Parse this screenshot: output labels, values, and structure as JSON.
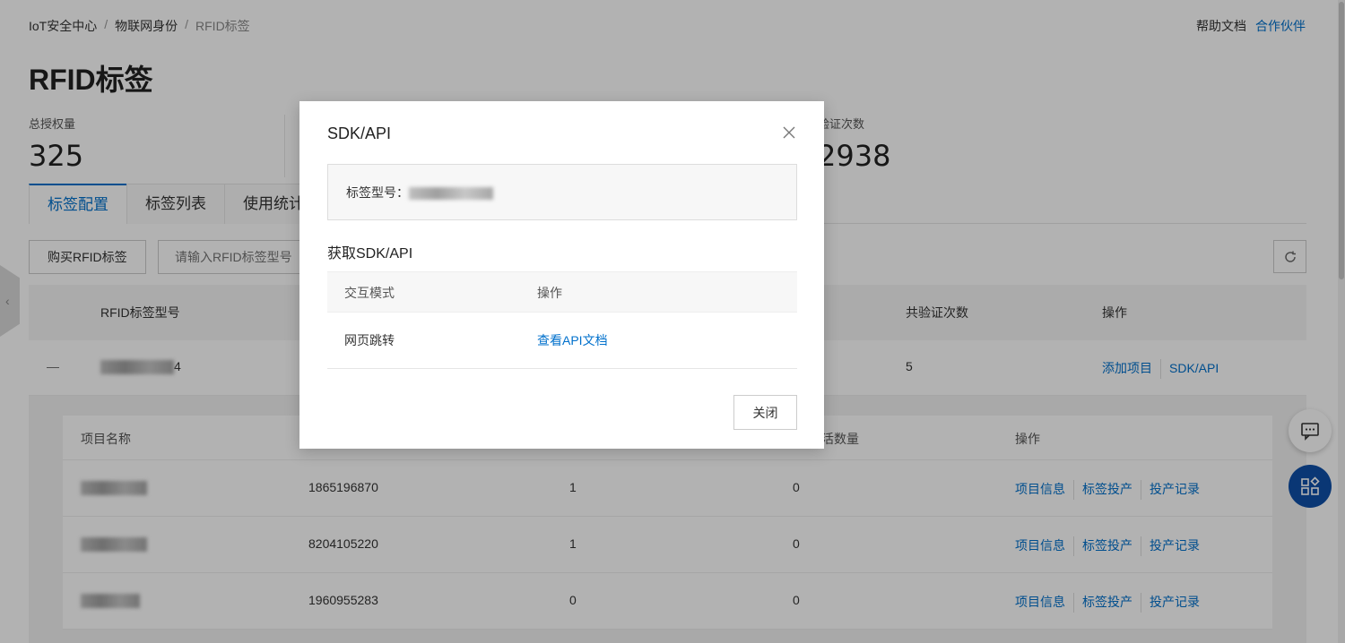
{
  "breadcrumb": [
    "IoT安全中心",
    "物联网身份",
    "RFID标签"
  ],
  "top_links": {
    "help": "帮助文档",
    "partner": "合作伙伴"
  },
  "page_title": "RFID标签",
  "stats": [
    {
      "label": "总授权量",
      "value": "325"
    },
    {
      "label": "验证次数",
      "value": "2938"
    }
  ],
  "tabs": [
    "标签配置",
    "标签列表",
    "使用统计"
  ],
  "toolbar": {
    "buy_label": "购买RFID标签",
    "search_placeholder": "请输入RFID标签型号"
  },
  "main_table": {
    "headers": {
      "model": "RFID标签型号",
      "verify_count": "共验证次数",
      "actions": "操作"
    },
    "row": {
      "collapse": "—",
      "model_suffix": "4",
      "verify_count": "5",
      "add_project": "添加项目",
      "sdk_api": "SDK/API"
    }
  },
  "sub_table": {
    "headers": {
      "name": "项目名称",
      "count_suffix": "活数量",
      "actions": "操作"
    },
    "rows": [
      {
        "id": "1865196870",
        "a": "1",
        "b": "0"
      },
      {
        "id": "8204105220",
        "a": "1",
        "b": "0"
      },
      {
        "id": "1960955283",
        "a": "0",
        "b": "0"
      }
    ],
    "actions": {
      "info": "项目信息",
      "assign": "标签投产",
      "record": "投产记录"
    }
  },
  "modal": {
    "title": "SDK/API",
    "model_label": "标签型号：",
    "section_title": "获取SDK/API",
    "table_headers": {
      "mode": "交互模式",
      "action": "操作"
    },
    "rows": [
      {
        "mode": "网页跳转",
        "action": "查看API文档"
      }
    ],
    "close_label": "关闭"
  },
  "colors": {
    "accent": "#0070cc",
    "float_apps": "#0f4fa8"
  }
}
